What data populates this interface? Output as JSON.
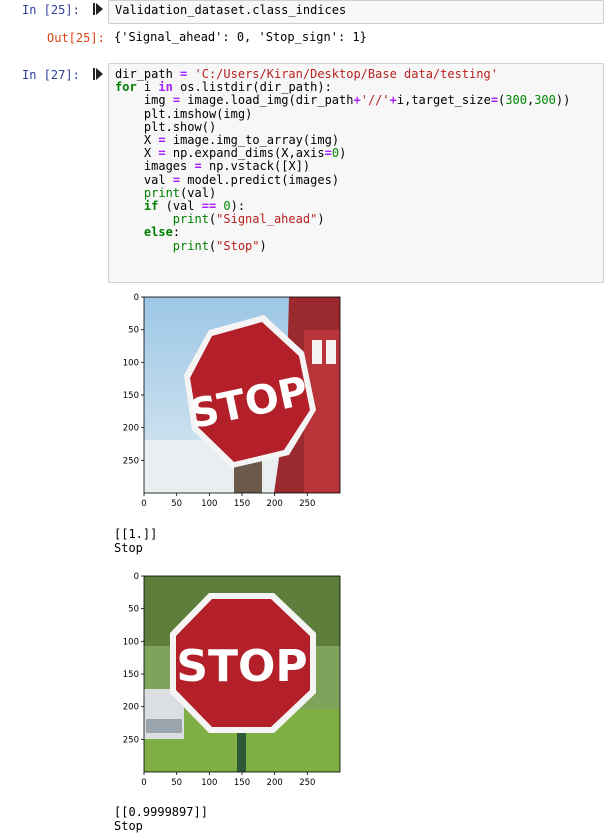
{
  "cell25": {
    "in_prompt": "In [25]:",
    "code": "Validation_dataset.class_indices",
    "out_prompt": "Out[25]:",
    "output": "{'Signal_ahead': 0, 'Stop_sign': 1}"
  },
  "cell27": {
    "in_prompt": "In [27]:",
    "code_lines": [
      "dir_path = 'C:/Users/Kiran/Desktop/Base data/testing'",
      "for i in os.listdir(dir_path):",
      "    img = image.load_img(dir_path+'//'+i,target_size=(300,300))",
      "    plt.imshow(img)",
      "    plt.show()",
      "    X = image.img_to_array(img)",
      "    X = np.expand_dims(X,axis=0)",
      "    images = np.vstack([X])",
      "    val = model.predict(images)",
      "    print(val)",
      "    if (val == 0):",
      "        print(\"Signal_ahead\")",
      "    else:",
      "        print(\"Stop\")"
    ],
    "outputs": [
      {
        "y_ticks": [
          "0",
          "50",
          "100",
          "150",
          "200",
          "250"
        ],
        "x_ticks": [
          "0",
          "50",
          "100",
          "150",
          "200",
          "250"
        ],
        "sign_text": "STOP",
        "printed_value": "[[1.]]",
        "printed_label": "Stop"
      },
      {
        "y_ticks": [
          "0",
          "50",
          "100",
          "150",
          "200",
          "250"
        ],
        "x_ticks": [
          "0",
          "50",
          "100",
          "150",
          "200",
          "250"
        ],
        "sign_text": "STOP",
        "printed_value": "[[0.9999897]]",
        "printed_label": "Stop"
      }
    ]
  },
  "colors": {
    "in_prompt": "#303f9f",
    "out_prompt": "#d84315",
    "stop_red": "#b3202a"
  }
}
